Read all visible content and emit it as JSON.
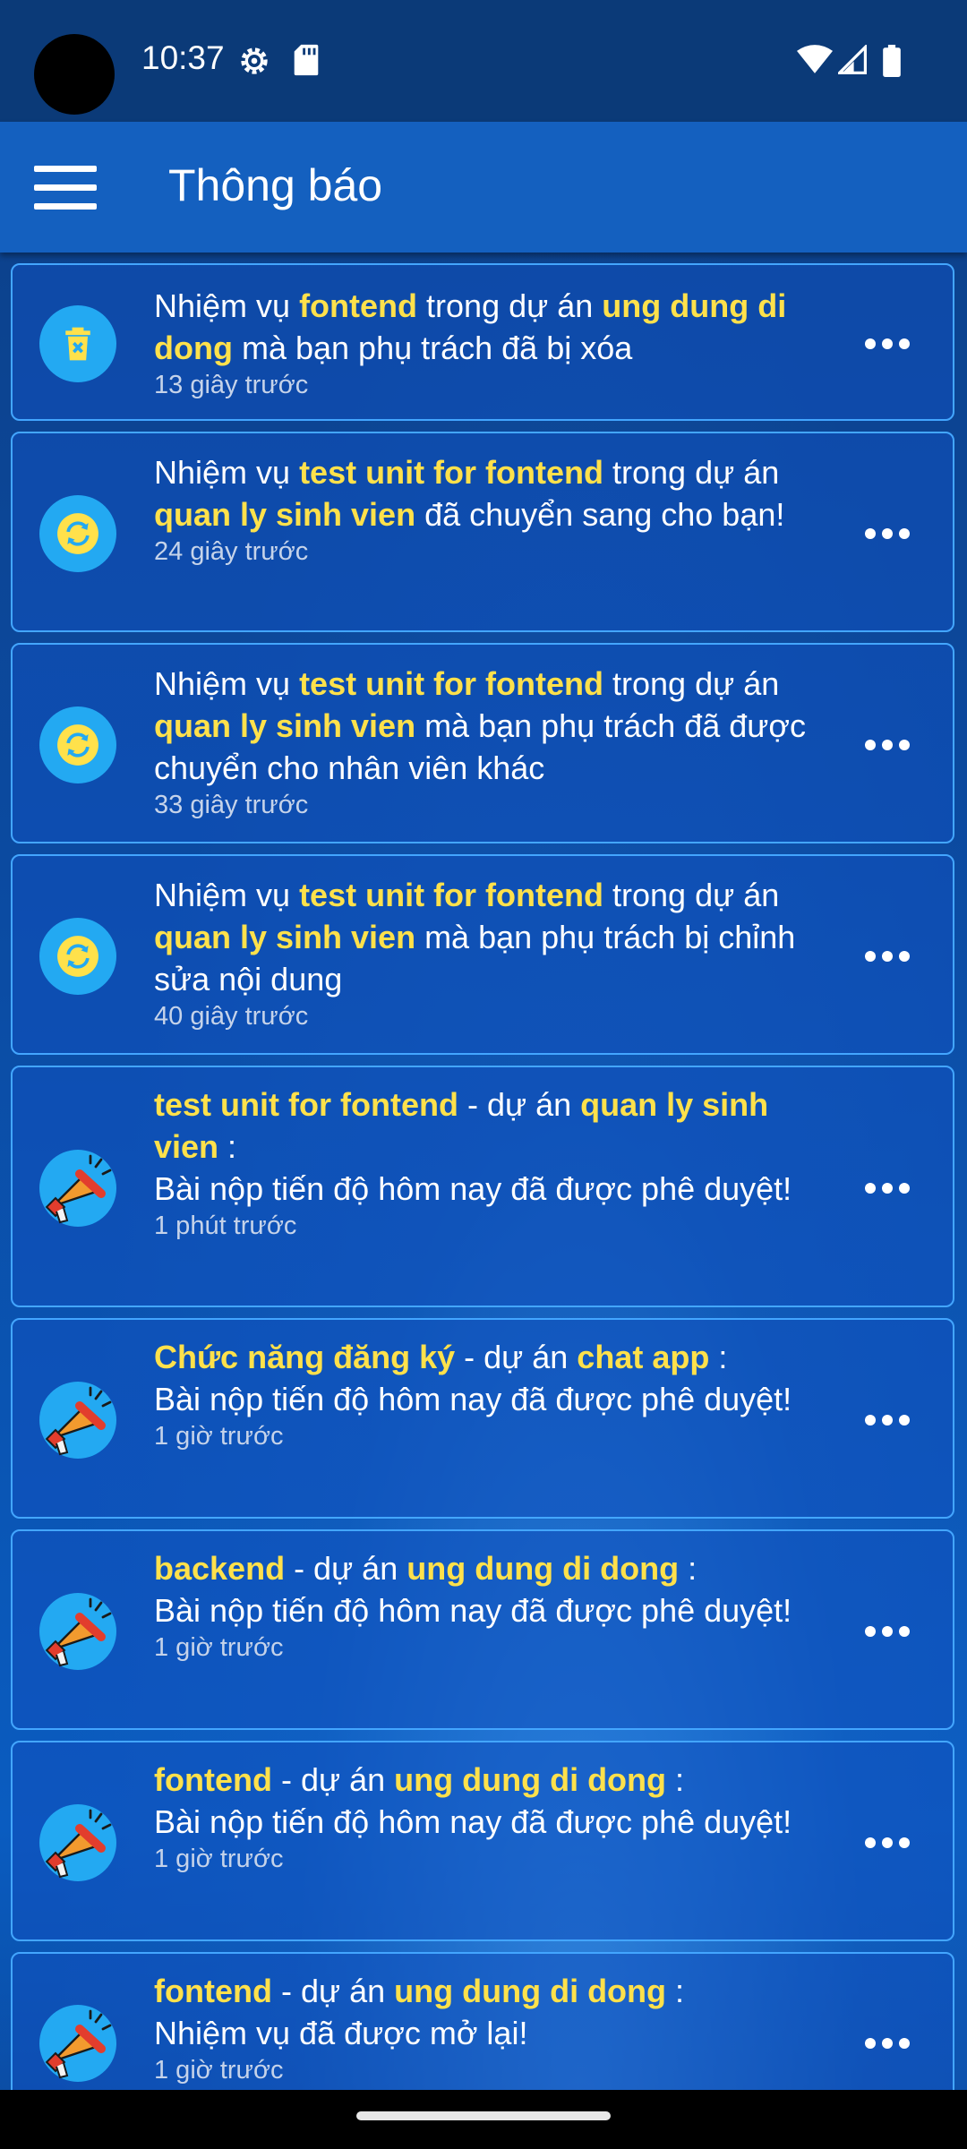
{
  "status_bar": {
    "time": "10:37"
  },
  "app_bar": {
    "title": "Thông báo"
  },
  "notifications": [
    {
      "icon": "trash-icon",
      "text": [
        [
          "Nhiệm vụ ",
          false
        ],
        [
          "fontend",
          true
        ],
        [
          " trong dự án ",
          false
        ],
        [
          "ung dung di dong",
          true
        ],
        [
          " mà bạn phụ trách đã bị xóa",
          false
        ]
      ],
      "time_ago": "13 giây trước"
    },
    {
      "icon": "sync-icon",
      "text": [
        [
          "Nhiệm vụ ",
          false
        ],
        [
          "test unit for fontend",
          true
        ],
        [
          " trong dự án ",
          false
        ],
        [
          "quan ly sinh vien",
          true
        ],
        [
          " đã chuyển sang cho bạn!",
          false
        ]
      ],
      "time_ago": "24 giây trước"
    },
    {
      "icon": "sync-icon",
      "text": [
        [
          "Nhiệm vụ ",
          false
        ],
        [
          "test unit for fontend",
          true
        ],
        [
          " trong dự án ",
          false
        ],
        [
          "quan ly sinh vien",
          true
        ],
        [
          " mà bạn phụ trách đã được chuyển cho nhân viên khác",
          false
        ]
      ],
      "time_ago": "33 giây trước"
    },
    {
      "icon": "sync-icon",
      "text": [
        [
          "Nhiệm vụ ",
          false
        ],
        [
          "test unit for fontend",
          true
        ],
        [
          " trong dự án ",
          false
        ],
        [
          "quan ly sinh vien",
          true
        ],
        [
          " mà bạn phụ trách bị chỉnh sửa nội dung",
          false
        ]
      ],
      "time_ago": "40 giây trước"
    },
    {
      "icon": "megaphone-icon",
      "text": [
        [
          "test unit for fontend",
          true
        ],
        [
          " - dự án ",
          false
        ],
        [
          "quan ly sinh vien",
          true
        ],
        [
          " :",
          false
        ]
      ],
      "body": "Bài nộp tiến độ hôm nay đã được phê duyệt!",
      "time_ago": "1 phút trước"
    },
    {
      "icon": "megaphone-icon",
      "text": [
        [
          "Chức năng đăng ký",
          true
        ],
        [
          " - dự án ",
          false
        ],
        [
          "chat app",
          true
        ],
        [
          " :",
          false
        ]
      ],
      "body": "Bài nộp tiến độ hôm nay đã được phê duyệt!",
      "time_ago": "1 giờ trước"
    },
    {
      "icon": "megaphone-icon",
      "text": [
        [
          "backend",
          true
        ],
        [
          " - dự án ",
          false
        ],
        [
          "ung dung di dong",
          true
        ],
        [
          " :",
          false
        ]
      ],
      "body": "Bài nộp tiến độ hôm nay đã được phê duyệt!",
      "time_ago": "1 giờ trước"
    },
    {
      "icon": "megaphone-icon",
      "text": [
        [
          "fontend",
          true
        ],
        [
          " - dự án ",
          false
        ],
        [
          "ung dung di dong",
          true
        ],
        [
          " :",
          false
        ]
      ],
      "body": "Bài nộp tiến độ hôm nay đã được phê duyệt!",
      "time_ago": "1 giờ trước"
    },
    {
      "icon": "megaphone-icon",
      "text": [
        [
          "fontend",
          true
        ],
        [
          " - dự án ",
          false
        ],
        [
          "ung dung di dong",
          true
        ],
        [
          " :",
          false
        ]
      ],
      "body": "Nhiệm vụ đã được mở lại!",
      "time_ago": "1 giờ trước"
    }
  ],
  "colors": {
    "highlight": "#ffe14b",
    "card_border": "#43a6ff",
    "app_bar": "#1460bf"
  }
}
